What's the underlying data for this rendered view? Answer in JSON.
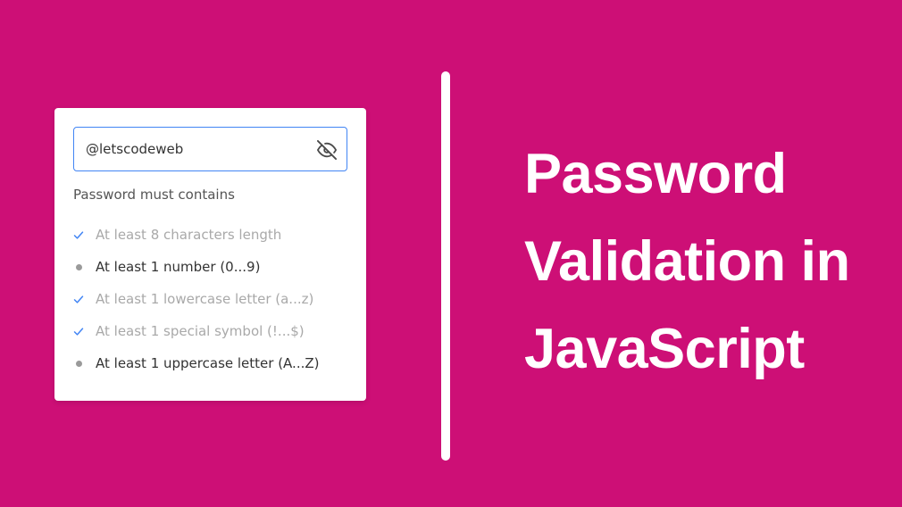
{
  "card": {
    "password_value": "@letscodeweb",
    "eye_icon": "eye-slash-icon",
    "requirements_title": "Password must contains",
    "requirements": [
      {
        "label": "At least 8 characters length",
        "valid": true
      },
      {
        "label": "At least 1 number (0...9)",
        "valid": false
      },
      {
        "label": "At least 1 lowercase letter (a...z)",
        "valid": true
      },
      {
        "label": "At least 1 special symbol (!...$)",
        "valid": true
      },
      {
        "label": "At least 1 uppercase letter (A...Z)",
        "valid": false
      }
    ]
  },
  "headline": {
    "line1": "Password",
    "line2": "Validation in",
    "line3": "JavaScript"
  },
  "colors": {
    "background": "#cd0f76",
    "accent": "#4285f4",
    "valid_text": "#a9a9a9",
    "invalid_text": "#333333"
  }
}
